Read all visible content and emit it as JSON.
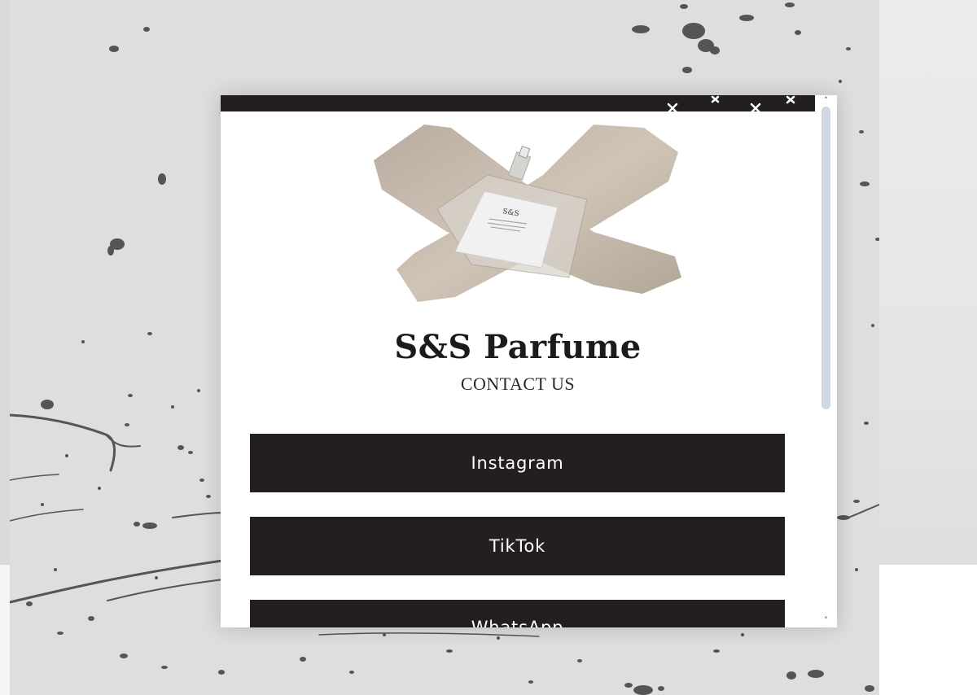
{
  "brand": {
    "name": "S&S Parfume",
    "tagline": "CONTACT US",
    "bottle_label": "S&S"
  },
  "links": [
    {
      "label": "Instagram"
    },
    {
      "label": "TikTok"
    },
    {
      "label": "WhatsApp"
    }
  ],
  "colors": {
    "button_bg": "#231f20",
    "button_text": "#ffffff",
    "splatter": "#555555",
    "panel_bg": "#dedede",
    "scroll_thumb": "#cfd8e2"
  },
  "icons": {
    "scroll_up": "chevron-up-icon",
    "scroll_down": "chevron-down-icon"
  }
}
